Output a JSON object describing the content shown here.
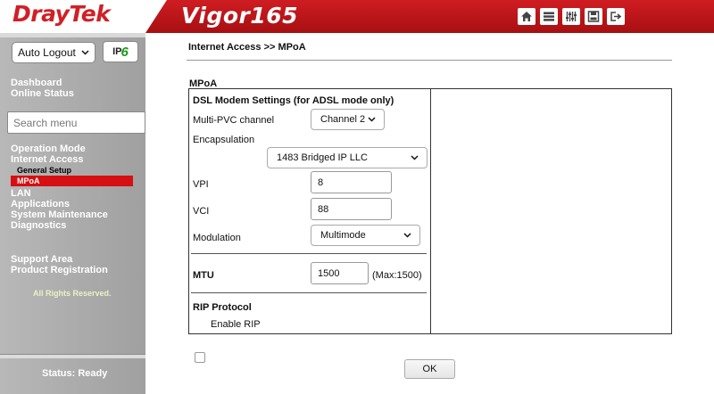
{
  "header": {
    "brand": "DrayTek",
    "model": "Vigor165",
    "icons": [
      "home-icon",
      "list-icon",
      "sliders-icon",
      "save-icon",
      "logout-icon"
    ],
    "brand_color": "#d11f26"
  },
  "sidebar": {
    "auto_logout": "Auto Logout",
    "ipv6_prefix": "IP",
    "ipv6_suffix": "6",
    "dashboard": "Dashboard",
    "online_status": "Online Status",
    "search_placeholder": "Search menu",
    "menu": [
      "Operation Mode",
      "Internet Access",
      "LAN",
      "Applications",
      "System Maintenance",
      "Diagnostics"
    ],
    "submenu": [
      "General Setup",
      "MPoA"
    ],
    "support_area": "Support Area",
    "product_registration": "Product Registration",
    "rights": "All Rights Reserved.",
    "status": "Status: Ready"
  },
  "main": {
    "breadcrumb": "Internet Access >> MPoA",
    "section_title": "MPoA",
    "dsl_title": "DSL Modem Settings (for ADSL mode only)",
    "multi_pvc_label": "Multi-PVC channel",
    "multi_pvc_value": "Channel 2",
    "encapsulation_label": "Encapsulation",
    "encapsulation_value": "1483 Bridged IP LLC",
    "vpi_label": "VPI",
    "vpi_value": "8",
    "vci_label": "VCI",
    "vci_value": "88",
    "modulation_label": "Modulation",
    "modulation_value": "Multimode",
    "mtu_label": "MTU",
    "mtu_value": "1500",
    "mtu_max": "(Max:1500)",
    "rip_title": "RIP Protocol",
    "enable_rip": "Enable RIP",
    "ok": "OK"
  }
}
